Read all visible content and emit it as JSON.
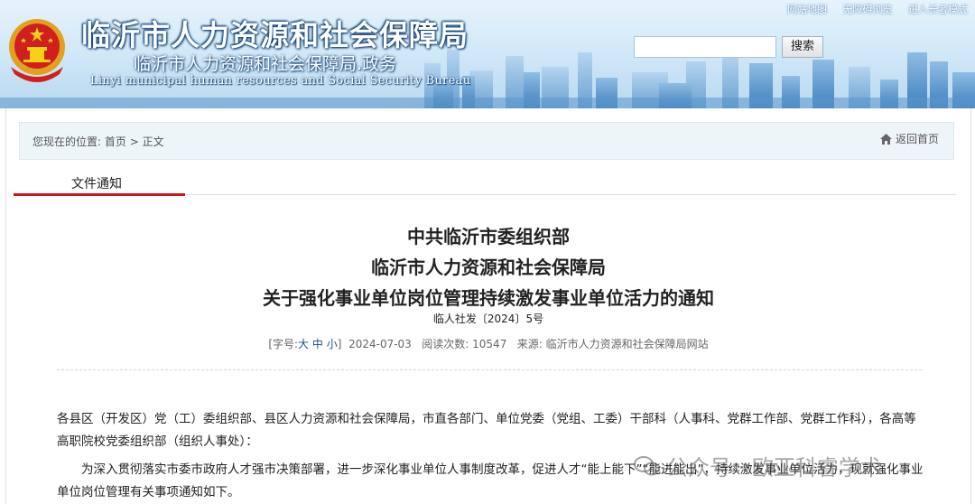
{
  "header": {
    "title_main": "临沂市人力资源和社会保障局",
    "title_sub": "临沂市人力资源和社会保障局.政务",
    "title_en": "Linyi municipal human resources and Social Security Bureau",
    "top_links": [
      "网站地图",
      "无障碍浏览",
      "进入长者模式"
    ],
    "search_placeholder": "",
    "search_button": "搜索"
  },
  "breadcrumb": {
    "prefix": "您现在的位置:",
    "home": "首页",
    "sep": ">",
    "current": "正文",
    "back_home": "返回首页"
  },
  "tab": {
    "label": "文件通知"
  },
  "article": {
    "title_line1": "中共临沂市委组织部",
    "title_line2": "临沂市人力资源和社会保障局",
    "title_line3": "关于强化事业单位岗位管理持续激发事业单位活力的通知",
    "doc_number": "临人社发〔2024〕5号",
    "meta": {
      "font_prefix": "[字号:",
      "size_large": "大",
      "size_medium": "中",
      "size_small": "小",
      "font_suffix": "]",
      "date": "2024-07-03",
      "views_label": "阅读次数:",
      "views": "10547",
      "source_label": "来源:",
      "source": "临沂市人力资源和社会保障局网站"
    },
    "para1": "各县区（开发区）党（工）委组织部、县区人力资源和社会保障局，市直各部门、单位党委（党组、工委）干部科（人事科、党群工作部、党群工作科），各高等高职院校党委组织部（组织人事处）：",
    "para2": "为深入贯彻落实市委市政府人才强市决策部署，进一步深化事业单位人事制度改革，促进人才“能上能下”“能进能出”，持续激发事业单位活力，现就强化事业单位岗位管理有关事项通知如下。"
  },
  "watermark": {
    "text": "公众号 · 欧亚科睿学术"
  },
  "colors": {
    "accent_red": "#c8161d",
    "header_blue": "#b8d8f0",
    "location_bg": "#eef5f9"
  }
}
